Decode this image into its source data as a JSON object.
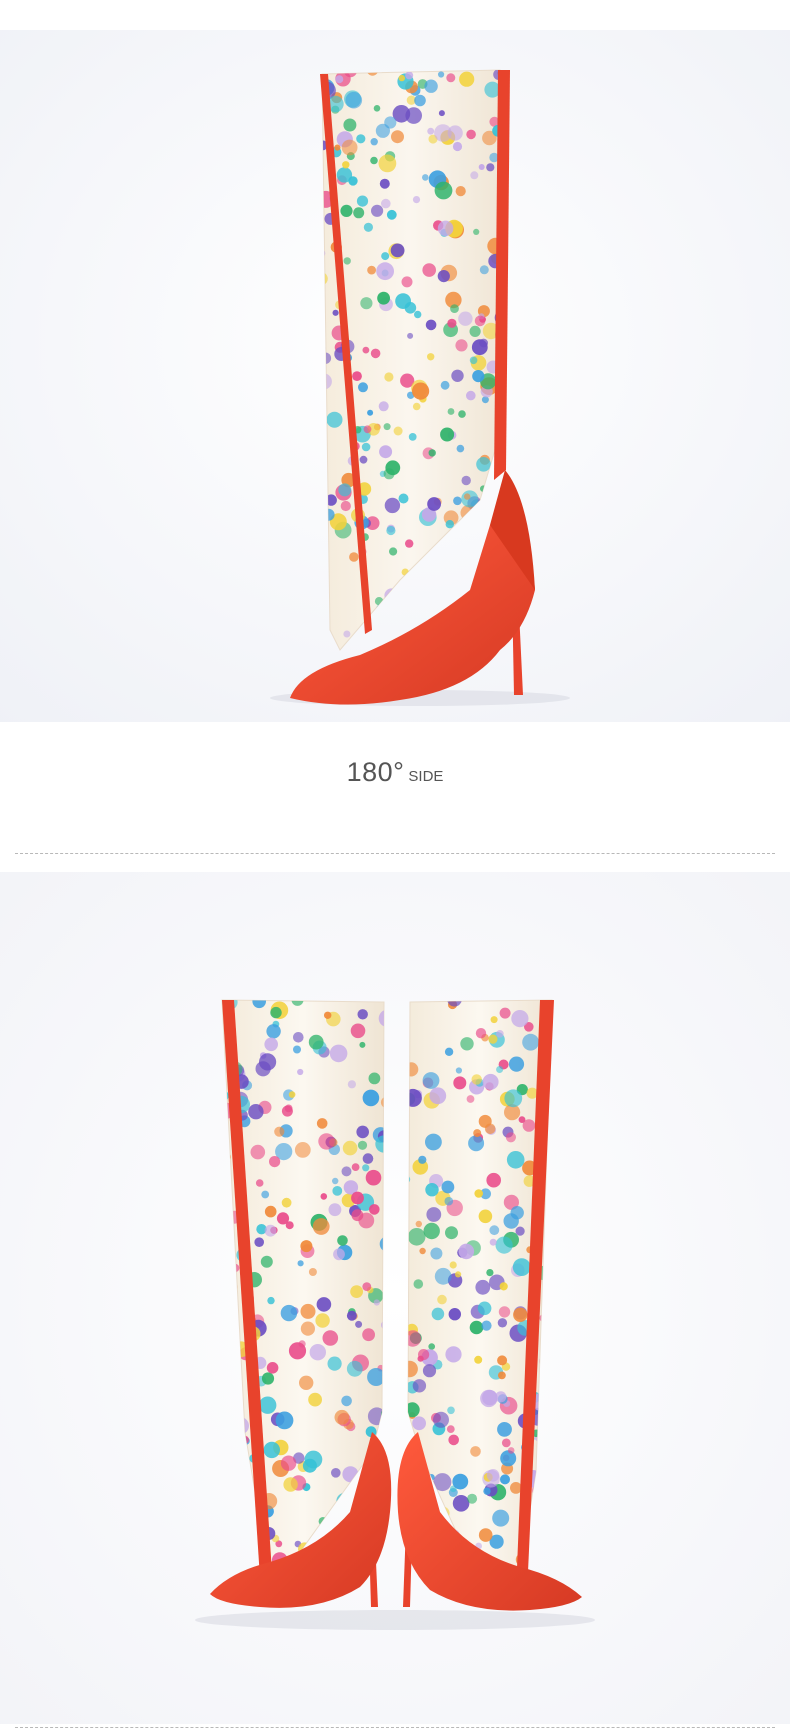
{
  "sections": [
    {
      "image": {
        "name": "knee-high-boot-side-view",
        "background": "#f6f7fb"
      },
      "caption": {
        "angle": "180°",
        "label": "SIDE"
      }
    },
    {
      "image": {
        "name": "knee-high-boots-front-pair",
        "background": "#f8f8fb"
      }
    }
  ],
  "colors": {
    "accent_red": "#e8432c",
    "dot_palette": [
      "#e94b8a",
      "#3b9fe0",
      "#2fb36b",
      "#f2d23c",
      "#6a4cc2",
      "#f08a3a",
      "#c4a8e8",
      "#36c1d6"
    ]
  }
}
